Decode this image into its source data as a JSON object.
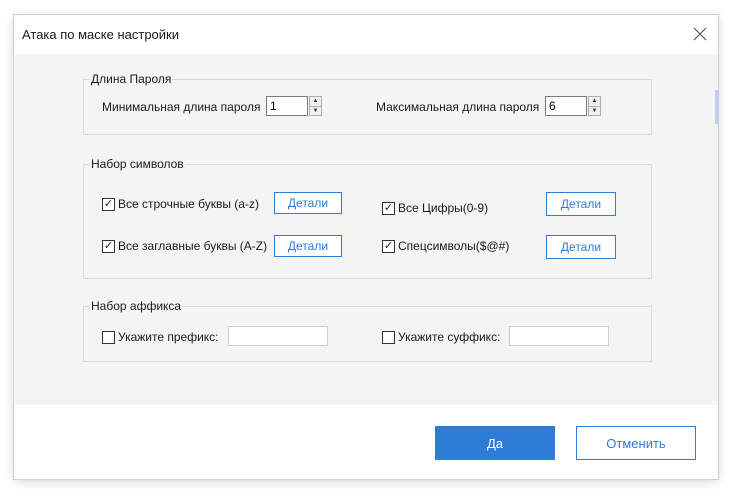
{
  "window": {
    "title": "Атака по маске настройки",
    "close_icon": "close-icon"
  },
  "password_length": {
    "legend": "Длина Пароля",
    "min_label": "Минимальная длина пароля",
    "min_value": "1",
    "max_label": "Максимальная длина пароля",
    "max_value": "6"
  },
  "charset": {
    "legend": "Набор символов",
    "lowercase": {
      "label": "Все строчные буквы (a-z)",
      "checked": true,
      "details": "Детали"
    },
    "digits": {
      "label": "Все Цифры(0-9)",
      "checked": true,
      "details": "Детали"
    },
    "uppercase": {
      "label": "Все заглавные буквы (A-Z)",
      "checked": true,
      "details": "Детали"
    },
    "special": {
      "label": "Спецсимволы($@#)",
      "checked": true,
      "details": "Детали"
    }
  },
  "affix": {
    "legend": "Набор аффикса",
    "prefix_label": "Укажите префикс:",
    "prefix_value": "",
    "suffix_label": "Укажите суффикс:",
    "suffix_value": ""
  },
  "footer": {
    "ok_label": "Да",
    "cancel_label": "Отменить"
  },
  "colors": {
    "accent": "#2f7cd8",
    "panel_bg": "#f4f4f4"
  }
}
